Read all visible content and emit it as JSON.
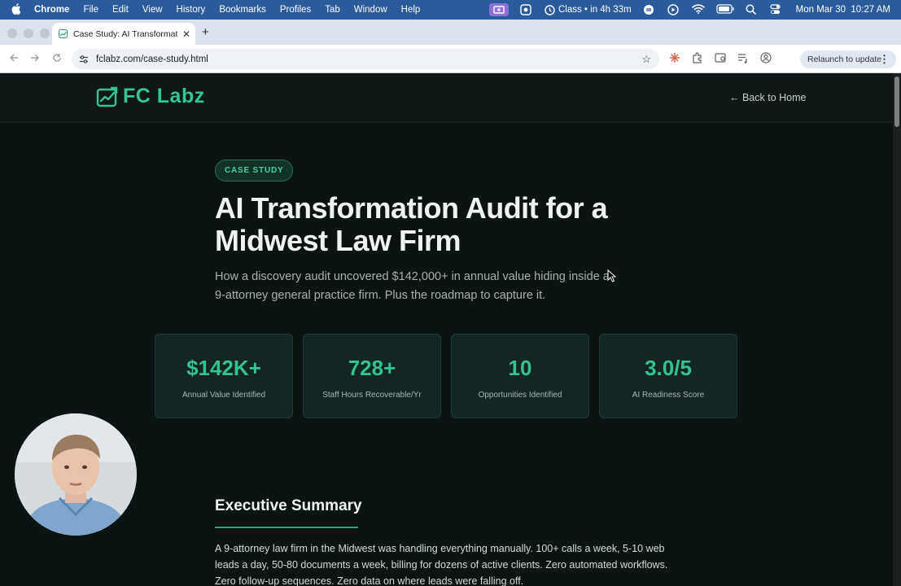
{
  "menubar": {
    "app": "Chrome",
    "items": [
      "File",
      "Edit",
      "View",
      "History",
      "Bookmarks",
      "Profiles",
      "Tab",
      "Window",
      "Help"
    ],
    "class_status": "Class • in 4h 33m",
    "datetime": "Mon Mar 30  10:27 AM"
  },
  "browser": {
    "tab_title": "Case Study: AI Transformation",
    "url": "fclabz.com/case-study.html",
    "relaunch_label": "Relaunch to update"
  },
  "site": {
    "logo_text": "FC Labz",
    "back_link": "← Back to Home",
    "brand_color": "#35c590"
  },
  "hero": {
    "badge": "CASE STUDY",
    "title": "AI Transformation Audit for a Midwest Law Firm",
    "subtitle": "How a discovery audit uncovered $142,000+ in annual value hiding inside a 9-attorney general practice firm. Plus the roadmap to capture it."
  },
  "stats": [
    {
      "value": "$142K+",
      "label": "Annual Value Identified"
    },
    {
      "value": "728+",
      "label": "Staff Hours Recoverable/Yr"
    },
    {
      "value": "10",
      "label": "Opportunities Identified"
    },
    {
      "value": "3.0/5",
      "label": "AI Readiness Score"
    }
  ],
  "executive_summary": {
    "heading": "Executive Summary",
    "body": "A 9-attorney law firm in the Midwest was handling everything manually. 100+ calls a week, 5-10 web leads a day, 50-80 documents a week, billing for dozens of active clients. Zero automated workflows. Zero follow-up sequences. Zero data on where leads were falling off."
  }
}
